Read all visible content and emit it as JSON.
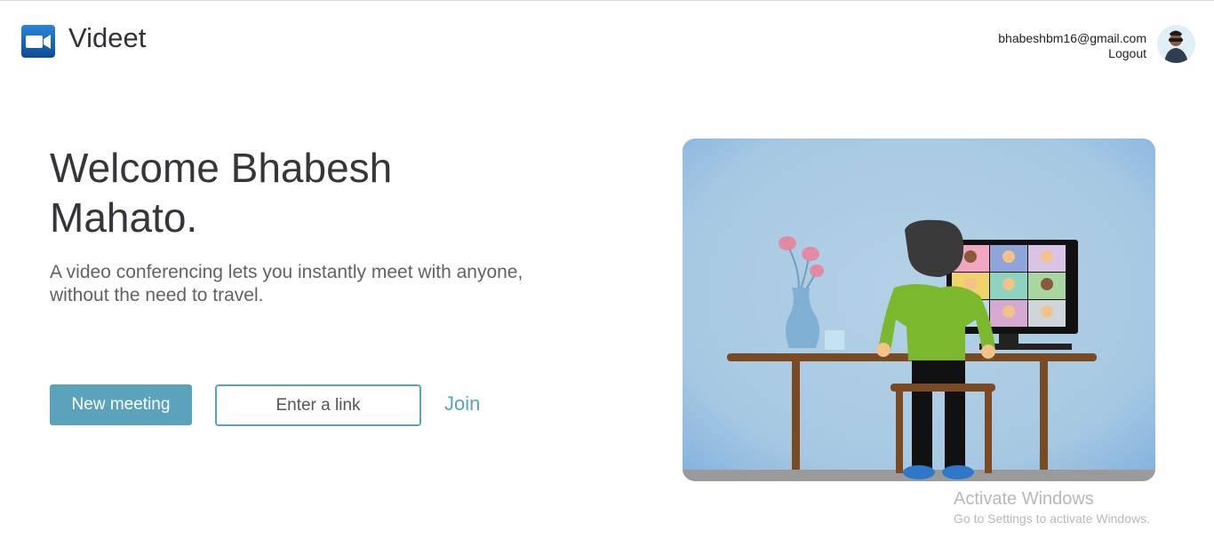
{
  "header": {
    "app_name": "Videet",
    "user_email": "bhabeshbm16@gmail.com",
    "logout_label": "Logout",
    "logo_icon": "video-camera-icon"
  },
  "hero": {
    "welcome": "Welcome Bhabesh Mahato.",
    "tagline": "A video conferencing lets you instantly meet with anyone, without the need to travel."
  },
  "actions": {
    "new_meeting_label": "New meeting",
    "link_placeholder": "Enter a link",
    "join_label": "Join"
  },
  "watermark": {
    "title": "Activate Windows",
    "subtitle": "Go to Settings to activate Windows."
  },
  "colors": {
    "accent": "#5ba3bd",
    "text_dark": "#34363b"
  }
}
